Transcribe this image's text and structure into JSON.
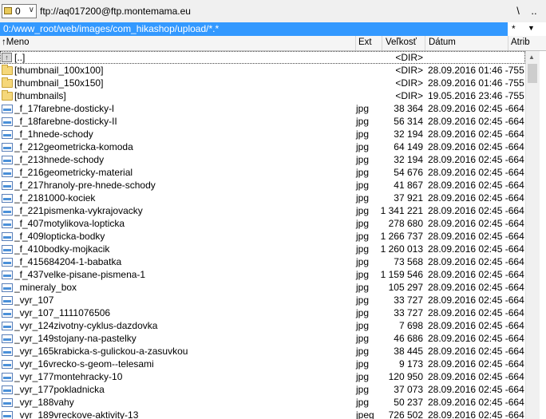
{
  "drivebar": {
    "drive": "0",
    "ftp_path": "ftp://aq017200@ftp.montemama.eu",
    "btn_root": "\\",
    "btn_up": ".."
  },
  "pathbar": {
    "path": "0:/www_root/web/images/com_hikashop/upload/*.*",
    "star": "*"
  },
  "columns": {
    "name": "Meno",
    "ext": "Ext",
    "size": "Veľkosť",
    "date": "Dátum",
    "attr": "Atrib"
  },
  "rows": [
    {
      "type": "up",
      "name": "[..]",
      "ext": "",
      "size": "<DIR>",
      "date": ""
    },
    {
      "type": "dir",
      "name": "[thumbnail_100x100]",
      "ext": "",
      "size": "<DIR>",
      "date": "28.09.2016 01:46 -755"
    },
    {
      "type": "dir",
      "name": "[thumbnail_150x150]",
      "ext": "",
      "size": "<DIR>",
      "date": "28.09.2016 01:46 -755"
    },
    {
      "type": "dir",
      "name": "[thumbnails]",
      "ext": "",
      "size": "<DIR>",
      "date": "19.05.2016 23:46 -755"
    },
    {
      "type": "file",
      "name": "_f_17farebne-dosticky-l",
      "ext": "jpg",
      "size": "38 364",
      "date": "28.09.2016 02:45 -664"
    },
    {
      "type": "file",
      "name": "_f_18farebne-dosticky-II",
      "ext": "jpg",
      "size": "56 314",
      "date": "28.09.2016 02:45 -664"
    },
    {
      "type": "file",
      "name": "_f_1hnede-schody",
      "ext": "jpg",
      "size": "32 194",
      "date": "28.09.2016 02:45 -664"
    },
    {
      "type": "file",
      "name": "_f_212geometricka-komoda",
      "ext": "jpg",
      "size": "64 149",
      "date": "28.09.2016 02:45 -664"
    },
    {
      "type": "file",
      "name": "_f_213hnede-schody",
      "ext": "jpg",
      "size": "32 194",
      "date": "28.09.2016 02:45 -664"
    },
    {
      "type": "file",
      "name": "_f_216geometricky-material",
      "ext": "jpg",
      "size": "54 676",
      "date": "28.09.2016 02:45 -664"
    },
    {
      "type": "file",
      "name": "_f_217hranoly-pre-hnede-schody",
      "ext": "jpg",
      "size": "41 867",
      "date": "28.09.2016 02:45 -664"
    },
    {
      "type": "file",
      "name": "_f_2181000-kociek",
      "ext": "jpg",
      "size": "37 921",
      "date": "28.09.2016 02:45 -664"
    },
    {
      "type": "file",
      "name": "_f_221pismenka-vykrajovacky",
      "ext": "jpg",
      "size": "1 341 221",
      "date": "28.09.2016 02:45 -664"
    },
    {
      "type": "file",
      "name": "_f_407motylikova-lopticka",
      "ext": "jpg",
      "size": "278 680",
      "date": "28.09.2016 02:45 -664"
    },
    {
      "type": "file",
      "name": "_f_409lopticka-bodky",
      "ext": "jpg",
      "size": "1 266 737",
      "date": "28.09.2016 02:45 -664"
    },
    {
      "type": "file",
      "name": "_f_410bodky-mojkacik",
      "ext": "jpg",
      "size": "1 260 013",
      "date": "28.09.2016 02:45 -664"
    },
    {
      "type": "file",
      "name": "_f_415684204-1-babatka",
      "ext": "jpg",
      "size": "73 568",
      "date": "28.09.2016 02:45 -664"
    },
    {
      "type": "file",
      "name": "_f_437velke-pisane-pismena-1",
      "ext": "jpg",
      "size": "1 159 546",
      "date": "28.09.2016 02:45 -664"
    },
    {
      "type": "file",
      "name": "_mineraly_box",
      "ext": "jpg",
      "size": "105 297",
      "date": "28.09.2016 02:45 -664"
    },
    {
      "type": "file",
      "name": "_vyr_107",
      "ext": "jpg",
      "size": "33 727",
      "date": "28.09.2016 02:45 -664"
    },
    {
      "type": "file",
      "name": "_vyr_107_1111076506",
      "ext": "jpg",
      "size": "33 727",
      "date": "28.09.2016 02:45 -664"
    },
    {
      "type": "file",
      "name": "_vyr_124zivotny-cyklus-dazdovka",
      "ext": "jpg",
      "size": "7 698",
      "date": "28.09.2016 02:45 -664"
    },
    {
      "type": "file",
      "name": "_vyr_149stojany-na-pastelky",
      "ext": "jpg",
      "size": "46 686",
      "date": "28.09.2016 02:45 -664"
    },
    {
      "type": "file",
      "name": "_vyr_165krabicka-s-gulickou-a-zasuvkou",
      "ext": "jpg",
      "size": "38 445",
      "date": "28.09.2016 02:45 -664"
    },
    {
      "type": "file",
      "name": "_vyr_16vrecko-s-geom--telesami",
      "ext": "jpg",
      "size": "9 173",
      "date": "28.09.2016 02:45 -664"
    },
    {
      "type": "file",
      "name": "_vyr_177montehracky-10",
      "ext": "jpg",
      "size": "120 950",
      "date": "28.09.2016 02:45 -664"
    },
    {
      "type": "file",
      "name": "_vyr_177pokladnicka",
      "ext": "jpg",
      "size": "37 073",
      "date": "28.09.2016 02:45 -664"
    },
    {
      "type": "file",
      "name": "_vyr_188vahy",
      "ext": "jpg",
      "size": "50 237",
      "date": "28.09.2016 02:45 -664"
    },
    {
      "type": "file",
      "name": "_vyr_189vreckove-aktivity-13",
      "ext": "jpeg",
      "size": "726 502",
      "date": "28.09.2016 02:45 -664"
    }
  ]
}
